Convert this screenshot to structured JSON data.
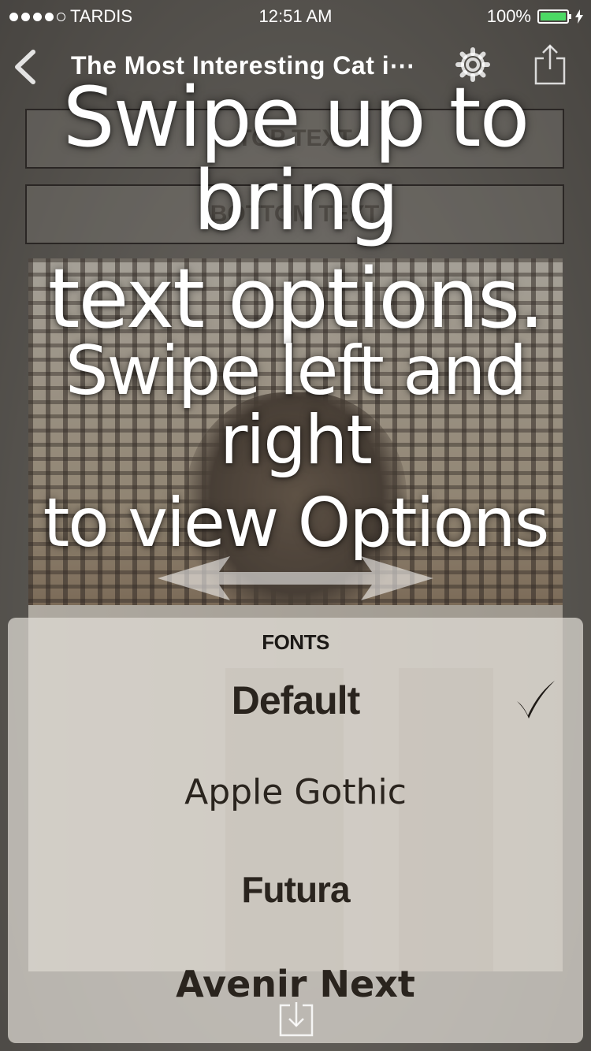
{
  "status_bar": {
    "signal_dots_filled": 4,
    "signal_dots_total": 5,
    "carrier": "TARDIS",
    "time": "12:51 AM",
    "battery": "100%",
    "battery_color": "#4cd964"
  },
  "nav": {
    "title": "The Most Interesting Cat i⋯",
    "back_icon": "chevron-left-icon",
    "settings_icon": "gear-icon",
    "share_icon": "share-icon"
  },
  "text_fields": {
    "top_placeholder": "TOP TEXT",
    "bottom_placeholder": "BOTTOM TEXT"
  },
  "overlay": {
    "hint_line1": "Swipe up to bring",
    "hint_line2": "text options.",
    "hint_line3": "Swipe left and right",
    "hint_line4": "to view Options",
    "arrow_icon": "double-arrow-icon"
  },
  "fonts_panel": {
    "title": "FONTS",
    "options": [
      {
        "label": "Default",
        "selected": true
      },
      {
        "label": "Apple Gothic",
        "selected": false
      },
      {
        "label": "Futura",
        "selected": false
      },
      {
        "label": "Avenir Next",
        "selected": false
      }
    ],
    "check_icon": "checkmark-icon",
    "save_icon": "download-icon"
  }
}
